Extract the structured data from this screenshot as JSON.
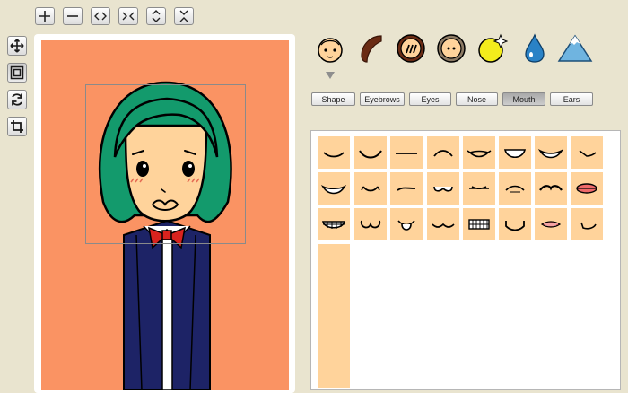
{
  "toolbar": {
    "buttons": [
      {
        "name": "zoom-in-button",
        "icon": "plus-icon"
      },
      {
        "name": "zoom-out-button",
        "icon": "minus-icon"
      },
      {
        "name": "widen-button",
        "icon": "expand-horizontal-icon"
      },
      {
        "name": "narrow-button",
        "icon": "contract-horizontal-icon"
      },
      {
        "name": "taller-button",
        "icon": "expand-vertical-icon"
      },
      {
        "name": "shorter-button",
        "icon": "contract-vertical-icon"
      }
    ]
  },
  "side_tools": [
    {
      "name": "move-tool",
      "icon": "move-arrows-icon",
      "active": false
    },
    {
      "name": "frame-tool",
      "icon": "frame-icon",
      "active": true
    },
    {
      "name": "rotate-tool",
      "icon": "refresh-icon",
      "active": false
    },
    {
      "name": "crop-tool",
      "icon": "crop-icon",
      "active": false
    }
  ],
  "categories": [
    {
      "name": "face",
      "icon": "face-icon",
      "selected": true
    },
    {
      "name": "hair",
      "icon": "hair-icon",
      "selected": false
    },
    {
      "name": "body",
      "icon": "body-icon",
      "selected": false
    },
    {
      "name": "mask",
      "icon": "mask-icon",
      "selected": false
    },
    {
      "name": "accessory",
      "icon": "sparkle-ball-icon",
      "selected": false
    },
    {
      "name": "effect",
      "icon": "water-drop-icon",
      "selected": false
    },
    {
      "name": "background",
      "icon": "mountain-icon",
      "selected": false
    }
  ],
  "tabs": [
    {
      "label": "Shape",
      "selected": false
    },
    {
      "label": "Eyebrows",
      "selected": false
    },
    {
      "label": "Eyes",
      "selected": false
    },
    {
      "label": "Nose",
      "selected": false
    },
    {
      "label": "Mouth",
      "selected": true
    },
    {
      "label": "Ears",
      "selected": false
    }
  ],
  "mouth_options": [
    "smile",
    "wide-smile",
    "flat",
    "frown",
    "wavy-smile",
    "grin",
    "big-smile",
    "smirk",
    "open-smile",
    "small-smile",
    "tilted",
    "cat",
    "flat-line",
    "soft-frown",
    "mustache",
    "lips",
    "teeth-grin",
    "w-mouth",
    "tongue",
    "wiggle",
    "teeth-box",
    "cup",
    "lipstick",
    "side-smile"
  ],
  "colors": {
    "canvas_bg": "#fa9363",
    "skin": "#ffd39b",
    "hair": "#139a6c",
    "uniform": "#1d2366",
    "bow": "#d9231e"
  }
}
